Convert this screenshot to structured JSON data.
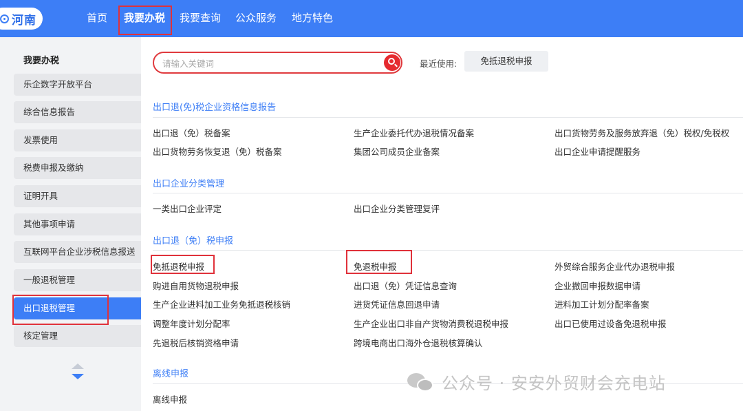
{
  "header": {
    "logo_text": "河南",
    "nav": [
      "首页",
      "我要办税",
      "我要查询",
      "公众服务",
      "地方特色"
    ]
  },
  "sidebar": {
    "title": "我要办税",
    "items": [
      "乐企数字开放平台",
      "综合信息报告",
      "发票使用",
      "税费申报及缴纳",
      "证明开具",
      "其他事项申请",
      "互联网平台企业涉税信息报送",
      "一般退税管理",
      "出口退税管理",
      "核定管理"
    ]
  },
  "search": {
    "placeholder": "请输入关键词",
    "recent_label": "最近使用:",
    "recent_item": "免抵退税申报"
  },
  "sections": [
    {
      "title": "出口退(免)税企业资格信息报告",
      "links": [
        "出口退（免）税备案",
        "生产企业委托代办退税情况备案",
        "出口货物劳务及服务放弃退（免）税权/免税权",
        "出口货物劳务恢复退（免）税备案",
        "集团公司成员企业备案",
        "出口企业申请提醒服务"
      ]
    },
    {
      "title": "出口企业分类管理",
      "links": [
        "一类出口企业评定",
        "出口企业分类管理复评"
      ]
    },
    {
      "title": "出口退（免）税申报",
      "links": [
        "免抵退税申报",
        "免退税申报",
        "外贸综合服务企业代办退税申报",
        "购进自用货物退税申报",
        "出口退（免）凭证信息查询",
        "企业撤回申报数据申请",
        "生产企业进料加工业务免抵退税核销",
        "进货凭证信息回退申请",
        "进料加工计划分配率备案",
        "调整年度计划分配率",
        "生产企业出口非自产货物消费税退税申报",
        "出口已使用过设备免退税申报",
        "先退税后核销资格申请",
        "跨境电商出口海外仓退税核算确认"
      ]
    },
    {
      "title": "离线申报",
      "links": [
        "离线申报"
      ]
    }
  ],
  "watermark": {
    "text": "公众号 · 安安外贸财会充电站"
  },
  "colors": {
    "primary": "#3d7ef6",
    "highlight": "#e0313a"
  }
}
